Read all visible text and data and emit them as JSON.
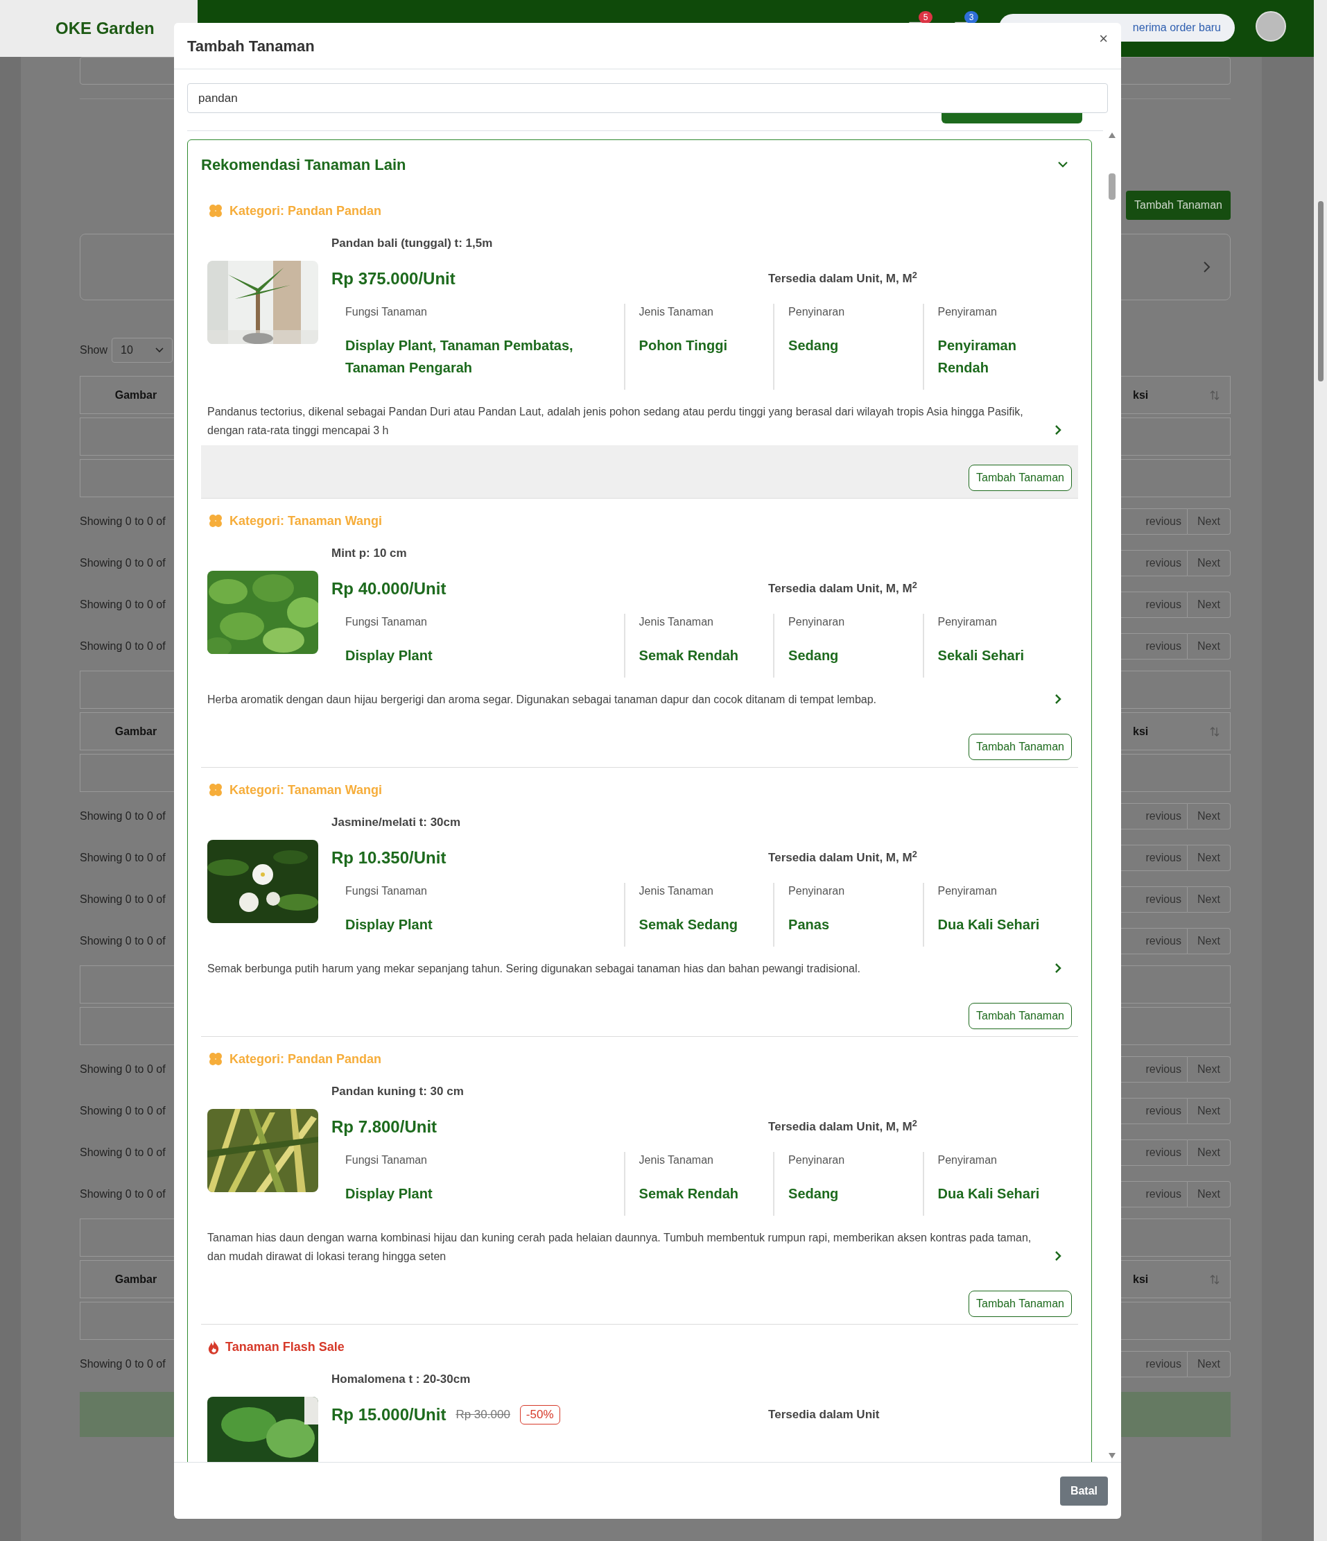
{
  "app": {
    "logo": "OKE Garden",
    "notifications": [
      {
        "count": "5",
        "color": "#dc3545"
      },
      {
        "count": "3",
        "color": "#2f6fd8"
      }
    ],
    "order_toggle": {
      "label": "nerima order baru"
    }
  },
  "background": {
    "add_button": "Tambah Tanaman",
    "show_label": "Show",
    "show_value": "10",
    "rows": [
      {
        "kind": "header",
        "left": "Gambar",
        "right": "ksi"
      },
      {
        "kind": "blank"
      },
      {
        "kind": "blank"
      },
      {
        "kind": "showing",
        "left": "Showing 0 to 0 of",
        "prev": "revious",
        "next": "Next"
      },
      {
        "kind": "showing",
        "left": "Showing 0 to 0 of",
        "prev": "revious",
        "next": "Next"
      },
      {
        "kind": "showing",
        "left": "Showing 0 to 0 of",
        "prev": "revious",
        "next": "Next"
      },
      {
        "kind": "showing",
        "left": "Showing 0 to 0 of",
        "prev": "revious",
        "next": "Next"
      },
      {
        "kind": "blank"
      },
      {
        "kind": "header",
        "left": "Gambar",
        "right": "ksi"
      },
      {
        "kind": "blank"
      },
      {
        "kind": "showing",
        "left": "Showing 0 to 0 of",
        "prev": "revious",
        "next": "Next"
      },
      {
        "kind": "showing",
        "left": "Showing 0 to 0 of",
        "prev": "revious",
        "next": "Next"
      },
      {
        "kind": "showing",
        "left": "Showing 0 to 0 of",
        "prev": "revious",
        "next": "Next"
      },
      {
        "kind": "showing",
        "left": "Showing 0 to 0 of",
        "prev": "revious",
        "next": "Next"
      },
      {
        "kind": "blank"
      },
      {
        "kind": "blank"
      },
      {
        "kind": "showing",
        "left": "Showing 0 to 0 of",
        "prev": "revious",
        "next": "Next"
      },
      {
        "kind": "showing",
        "left": "Showing 0 to 0 of",
        "prev": "revious",
        "next": "Next"
      },
      {
        "kind": "showing",
        "left": "Showing 0 to 0 of",
        "prev": "revious",
        "next": "Next"
      },
      {
        "kind": "showing",
        "left": "Showing 0 to 0 of",
        "prev": "revious",
        "next": "Next"
      },
      {
        "kind": "blank"
      },
      {
        "kind": "header",
        "left": "Gambar",
        "right": "ksi"
      },
      {
        "kind": "blank"
      },
      {
        "kind": "showing",
        "left": "Showing 0 to 0 of",
        "prev": "revious",
        "next": "Next"
      }
    ]
  },
  "modal": {
    "title": "Tambah Tanaman",
    "close": "×",
    "search": {
      "value": "pandan"
    },
    "panel": {
      "title": "Rekomendasi Tanaman Lain",
      "expanded": true,
      "items": [
        {
          "category": {
            "kind": "category",
            "label": "Kategori: Pandan Pandan"
          },
          "name": "Pandan bali (tunggal) t: 1,5m",
          "price": "Rp 375.000/Unit",
          "availability": "Tersedia dalam Unit, M, M$^{2}$",
          "attributes": [
            {
              "label": "Fungsi Tanaman",
              "value": "Display Plant, Tanaman Pembatas, Tanaman Pengarah"
            },
            {
              "label": "Jenis Tanaman",
              "value": "Pohon Tinggi"
            },
            {
              "label": "Penyinaran",
              "value": "Sedang"
            },
            {
              "label": "Penyiraman",
              "value": "Penyiraman Rendah"
            }
          ],
          "description": "Pandanus tectorius, dikenal sebagai Pandan Duri atau Pandan Laut, adalah jenis pohon sedang atau perdu tinggi yang berasal dari wilayah tropis Asia hingga Pasifik, dengan rata-rata tinggi mencapai 3 h",
          "button": "Tambah Tanaman",
          "hovered": true
        },
        {
          "category": {
            "kind": "category",
            "label": "Kategori: Tanaman Wangi"
          },
          "name": "Mint p: 10 cm",
          "price": "Rp 40.000/Unit",
          "availability": "Tersedia dalam Unit, M, M$^{2}$",
          "attributes": [
            {
              "label": "Fungsi Tanaman",
              "value": "Display Plant"
            },
            {
              "label": "Jenis Tanaman",
              "value": "Semak Rendah"
            },
            {
              "label": "Penyinaran",
              "value": "Sedang"
            },
            {
              "label": "Penyiraman",
              "value": "Sekali Sehari"
            }
          ],
          "description": "Herba aromatik dengan daun hijau bergerigi dan aroma segar. Digunakan sebagai tanaman dapur dan cocok ditanam di tempat lembap.",
          "button": "Tambah Tanaman",
          "hovered": false
        },
        {
          "category": {
            "kind": "category",
            "label": "Kategori: Tanaman Wangi"
          },
          "name": "Jasmine/melati t: 30cm",
          "price": "Rp 10.350/Unit",
          "availability": "Tersedia dalam Unit, M, M$^{2}$",
          "attributes": [
            {
              "label": "Fungsi Tanaman",
              "value": "Display Plant"
            },
            {
              "label": "Jenis Tanaman",
              "value": "Semak Sedang"
            },
            {
              "label": "Penyinaran",
              "value": "Panas"
            },
            {
              "label": "Penyiraman",
              "value": "Dua Kali Sehari"
            }
          ],
          "description": "Semak berbunga putih harum yang mekar sepanjang tahun. Sering digunakan sebagai tanaman hias dan bahan pewangi tradisional.",
          "button": "Tambah Tanaman",
          "hovered": false
        },
        {
          "category": {
            "kind": "category",
            "label": "Kategori: Pandan Pandan"
          },
          "name": "Pandan kuning t: 30 cm",
          "price": "Rp 7.800/Unit",
          "availability": "Tersedia dalam Unit, M, M$^{2}$",
          "attributes": [
            {
              "label": "Fungsi Tanaman",
              "value": "Display Plant"
            },
            {
              "label": "Jenis Tanaman",
              "value": "Semak Rendah"
            },
            {
              "label": "Penyinaran",
              "value": "Sedang"
            },
            {
              "label": "Penyiraman",
              "value": "Dua Kali Sehari"
            }
          ],
          "description": "Tanaman hias daun dengan warna kombinasi hijau dan kuning cerah pada helaian daunnya. Tumbuh membentuk rumpun rapi, memberikan aksen kontras pada taman, dan mudah dirawat di lokasi terang hingga seten",
          "button": "Tambah Tanaman",
          "hovered": false
        },
        {
          "category": {
            "kind": "flash_sale",
            "label": "Tanaman Flash Sale"
          },
          "name": "Homalomena t : 20-30cm",
          "price": "Rp 15.000/Unit",
          "original_price": "Rp 30.000",
          "discount": "-50%",
          "availability": "Tersedia dalam Unit"
        }
      ]
    },
    "cancel": "Batal"
  }
}
